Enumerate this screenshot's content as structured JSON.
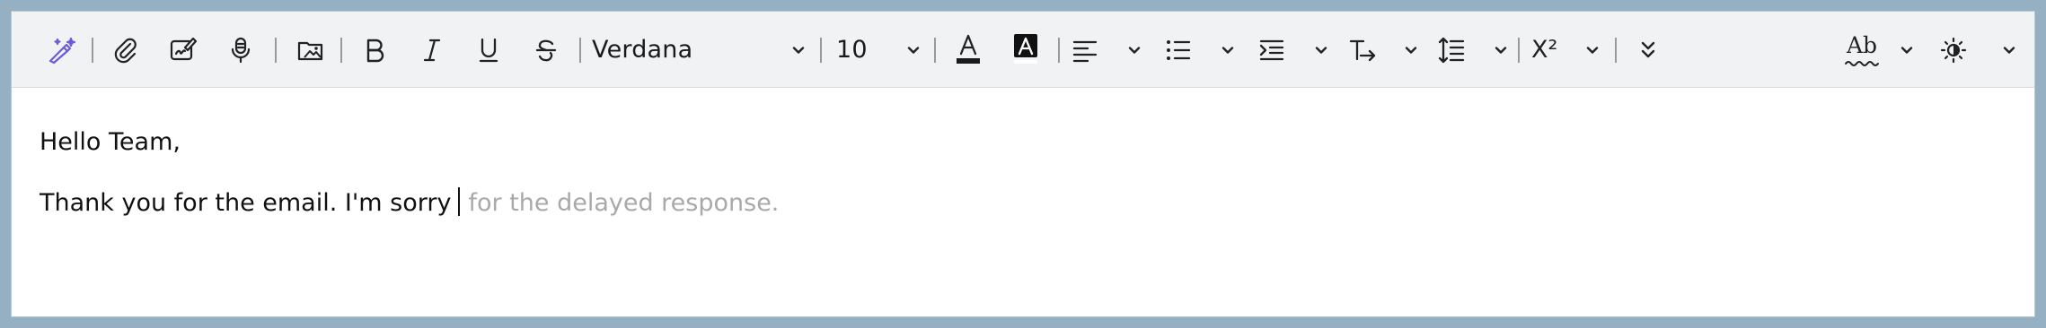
{
  "toolbar": {
    "ai_assist_icon": "sparkle-pen-icon",
    "attach_icon": "paperclip-icon",
    "signature_icon": "signature-icon",
    "dictate_icon": "microphone-icon",
    "insert_image_icon": "image-folder-icon",
    "bold_icon": "bold-icon",
    "italic_icon": "italic-icon",
    "underline_icon": "underline-icon",
    "strikethrough_icon": "strikethrough-icon",
    "font_family": "Verdana",
    "font_size": "10",
    "font_color_icon": "font-color-icon",
    "highlight_icon": "highlight-color-icon",
    "align_icon": "align-left-icon",
    "bullets_icon": "bullet-list-icon",
    "indent_icon": "indent-icon",
    "clear_format_icon": "clear-formatting-icon",
    "line_spacing_icon": "line-spacing-icon",
    "superscript_icon": "superscript-icon",
    "more_icon": "more-options-icon",
    "editor_icon": "spelling-icon",
    "editor_label": "Ab",
    "theme_icon": "theme-toggle-icon",
    "superscript_label": "X²"
  },
  "colors": {
    "accent_purple": "#6b5bd6",
    "font_color_bar": "#1a1a1a",
    "suggestion_text": "#a9a9a9",
    "toolbar_bg": "#f1f2f4",
    "frame_border": "#94b0c2"
  },
  "editor": {
    "greeting": "Hello Team,",
    "typed_text": "Thank you for the email. I'm sorry",
    "suggestion_text": "for the delayed response."
  }
}
